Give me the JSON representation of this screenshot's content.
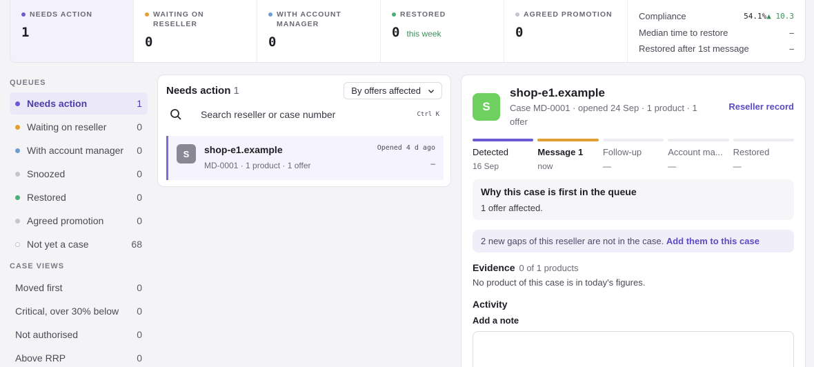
{
  "stats": [
    {
      "label": "NEEDS ACTION",
      "value": "1",
      "sub": "",
      "color": "#6b5bd2",
      "active": true
    },
    {
      "label": "WAITING ON RESELLER",
      "value": "0",
      "sub": "",
      "color": "#e0a032",
      "active": false
    },
    {
      "label": "WITH ACCOUNT MANAGER",
      "value": "0",
      "sub": "",
      "color": "#6e9fd2",
      "active": false
    },
    {
      "label": "RESTORED",
      "value": "0",
      "sub": "this week",
      "color": "#4caf78",
      "active": false
    },
    {
      "label": "AGREED PROMOTION",
      "value": "0",
      "sub": "",
      "color": "#c5c5cf",
      "active": false
    }
  ],
  "metrics": [
    {
      "label": "Compliance",
      "value": "54.1%",
      "trend": "▲ 10.3"
    },
    {
      "label": "Median time to restore",
      "value": "–",
      "trend": ""
    },
    {
      "label": "Restored after 1st message",
      "value": "–",
      "trend": ""
    }
  ],
  "sidebar": {
    "queues_title": "QUEUES",
    "queues": [
      {
        "label": "Needs action",
        "count": "1",
        "color": "#6b5bd2",
        "active": true,
        "hollow": false
      },
      {
        "label": "Waiting on reseller",
        "count": "0",
        "color": "#e0a032",
        "active": false,
        "hollow": false
      },
      {
        "label": "With account manager",
        "count": "0",
        "color": "#6e9fd2",
        "active": false,
        "hollow": false
      },
      {
        "label": "Snoozed",
        "count": "0",
        "color": "#c5c5cf",
        "active": false,
        "hollow": false
      },
      {
        "label": "Restored",
        "count": "0",
        "color": "#4caf78",
        "active": false,
        "hollow": false
      },
      {
        "label": "Agreed promotion",
        "count": "0",
        "color": "#c5c5cf",
        "active": false,
        "hollow": false
      },
      {
        "label": "Not yet a case",
        "count": "68",
        "color": "#ffffff",
        "active": false,
        "hollow": true
      }
    ],
    "views_title": "CASE VIEWS",
    "views": [
      {
        "label": "Moved first",
        "count": "0"
      },
      {
        "label": "Critical, over 30% below",
        "count": "0"
      },
      {
        "label": "Not authorised",
        "count": "0"
      },
      {
        "label": "Above RRP",
        "count": "0"
      }
    ]
  },
  "list": {
    "title": "Needs action",
    "count": "1",
    "sort_label": "By offers affected",
    "search_placeholder": "Search reseller or case number",
    "shortcut": "Ctrl K",
    "rows": [
      {
        "avatar": "S",
        "name": "shop-e1.example",
        "meta": "MD-0001 · 1 product · 1 offer",
        "opened": "Opened 4 d ago",
        "extra": "–"
      }
    ]
  },
  "detail": {
    "avatar": "S",
    "avatar_color": "#6ed05e",
    "title": "shop-e1.example",
    "subtitle": "Case MD-0001 · opened 24 Sep · 1 product · 1 offer",
    "reseller_link": "Reseller record",
    "steps": [
      {
        "label": "Detected",
        "date": "16 Sep",
        "color": "#6b5bd2",
        "state": "done"
      },
      {
        "label": "Message 1",
        "date": "now",
        "color": "#e0a032",
        "state": "cur"
      },
      {
        "label": "Follow-up",
        "date": "—",
        "color": "#ececf1",
        "state": "todo"
      },
      {
        "label": "Account ma...",
        "date": "—",
        "color": "#ececf1",
        "state": "todo"
      },
      {
        "label": "Restored",
        "date": "—",
        "color": "#ececf1",
        "state": "todo"
      }
    ],
    "why_title": "Why this case is first in the queue",
    "why_text": "1 offer affected.",
    "gap_text": "2 new gaps of this reseller are not in the case.",
    "gap_link": "Add them to this case",
    "evidence_title": "Evidence",
    "evidence_sub": "0 of 1 products",
    "evidence_text": "No product of this case is in today's figures.",
    "activity_title": "Activity",
    "note_label": "Add a note"
  }
}
